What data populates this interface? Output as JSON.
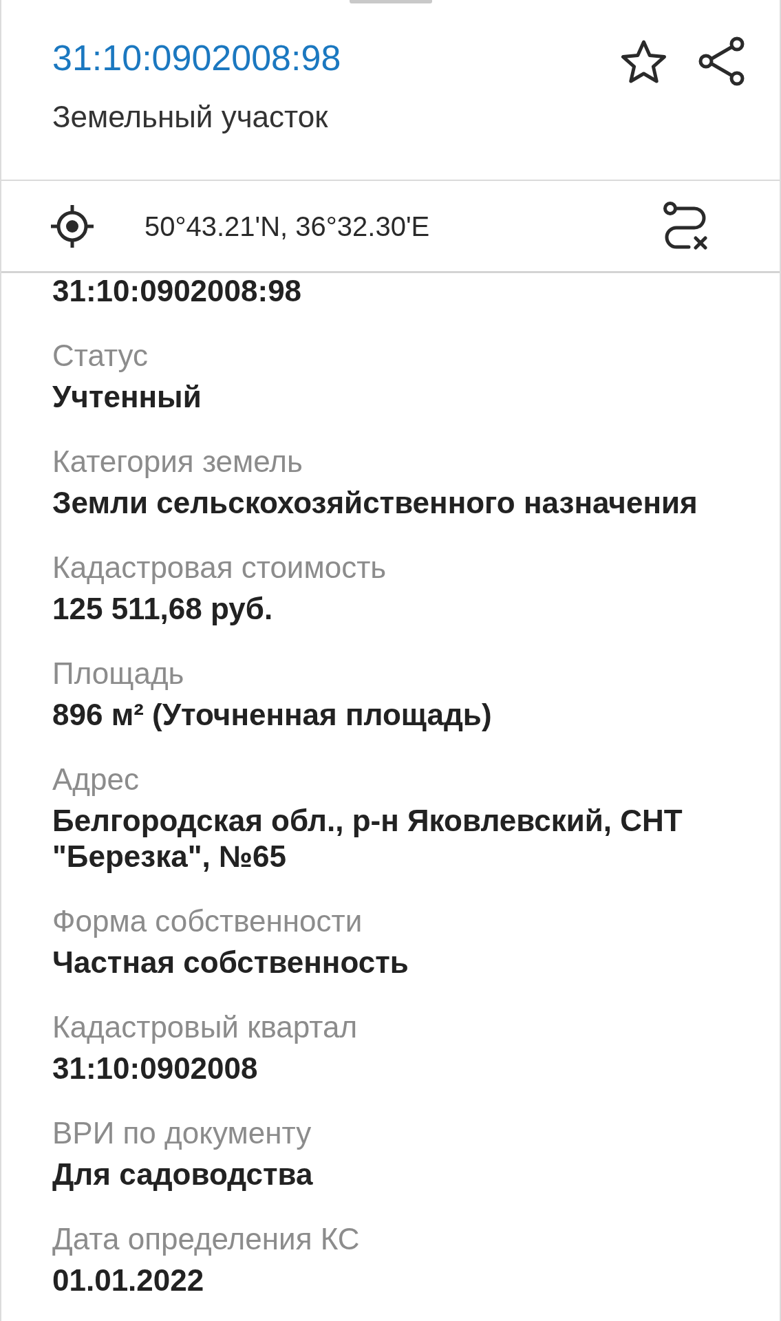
{
  "header": {
    "title": "31:10:0902008:98",
    "subtitle": "Земельный участок"
  },
  "location": {
    "coordinates": "50°43.21'N, 36°32.30'E"
  },
  "cadastral_number": "31:10:0902008:98",
  "fields": [
    {
      "label": "Статус",
      "value": "Учтенный"
    },
    {
      "label": "Категория земель",
      "value": "Земли сельскохозяйственного назначения"
    },
    {
      "label": "Кадастровая стоимость",
      "value": "125 511,68 руб."
    },
    {
      "label": "Площадь",
      "value": "896 м² (Уточненная площадь)"
    },
    {
      "label": "Адрес",
      "value": "Белгородская обл., р-н Яковлевский, СНТ \"Березка\", №65"
    },
    {
      "label": "Форма собственности",
      "value": "Частная собственность"
    },
    {
      "label": "Кадастровый квартал",
      "value": "31:10:0902008"
    },
    {
      "label": "ВРИ по документу",
      "value": "Для садоводства"
    },
    {
      "label": "Дата определения КС",
      "value": "01.01.2022"
    }
  ]
}
